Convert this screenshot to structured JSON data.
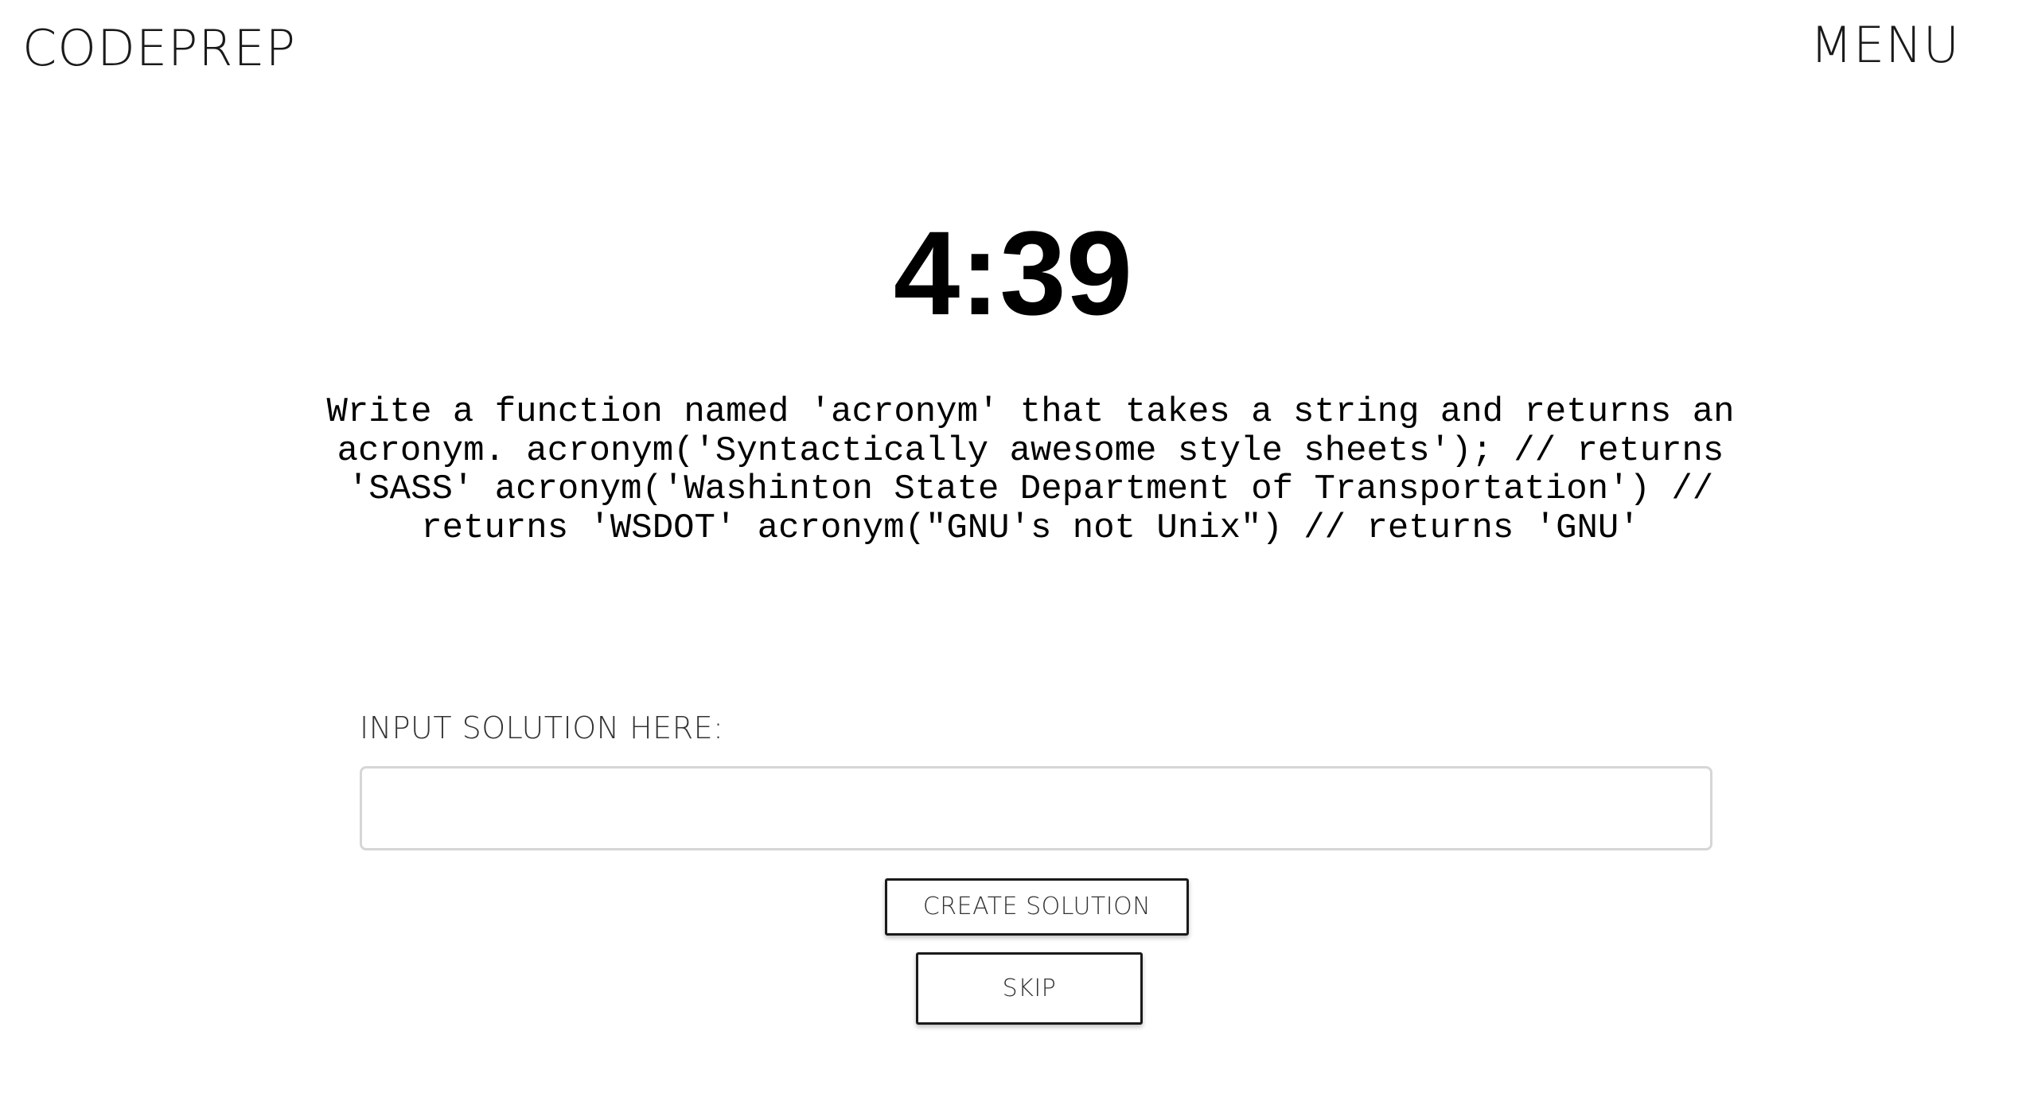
{
  "header": {
    "brand": "CODEPREP",
    "menu_label": "MENU"
  },
  "challenge": {
    "timer": "4:39",
    "prompt": "Write a function named 'acronym' that takes a string and returns an acronym. acronym('Syntactically awesome style sheets'); // returns 'SASS' acronym('Washinton State Department of Transportation') // returns 'WSDOT' acronym(\"GNU's not Unix\") // returns 'GNU'"
  },
  "solution": {
    "label": "INPUT SOLUTION HERE:",
    "value": "",
    "placeholder": ""
  },
  "actions": {
    "create_label": "CREATE SOLUTION",
    "skip_label": "SKIP"
  }
}
